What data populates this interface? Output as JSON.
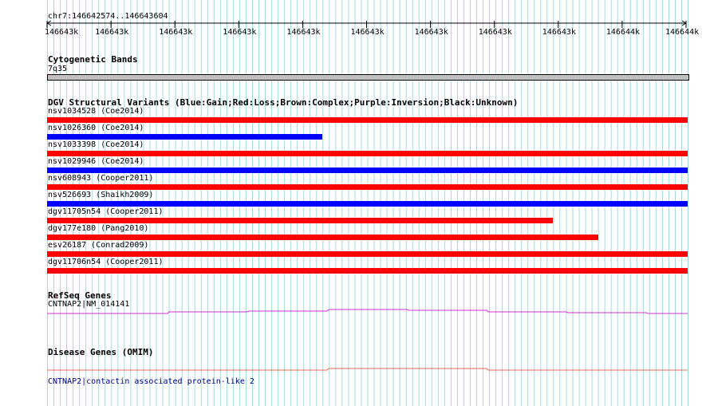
{
  "ruler": {
    "coords": "chr7:146642574..146643604",
    "tick_labels": [
      "146643k",
      "146643k",
      "146643k",
      "146643k",
      "146643k",
      "146643k",
      "146643k",
      "146643k",
      "146643k",
      "146644k",
      "146644k"
    ]
  },
  "cytoband": {
    "title": "Cytogenetic Bands",
    "band_label": "7q35",
    "band_color": "#c0c0c0"
  },
  "dgv": {
    "title": "DGV Structural Variants (Blue:Gain;Red:Loss;Brown:Complex;Purple:Inversion;Black:Unknown)",
    "variants": [
      {
        "label": "nsv1034528 (Coe2014)",
        "color": "#ff0000",
        "extent": 1.0
      },
      {
        "label": "nsv1026360 (Coe2014)",
        "color": "#0000ff",
        "extent": 0.43
      },
      {
        "label": "nsv1033398 (Coe2014)",
        "color": "#ff0000",
        "extent": 1.0
      },
      {
        "label": "nsv1029946 (Coe2014)",
        "color": "#0000ff",
        "extent": 1.0
      },
      {
        "label": "nsv608943 (Cooper2011)",
        "color": "#ff0000",
        "extent": 1.0
      },
      {
        "label": "nsv526693 (Shaikh2009)",
        "color": "#0000ff",
        "extent": 1.0
      },
      {
        "label": "dgv11705n54 (Cooper2011)",
        "color": "#ff0000",
        "extent": 0.79
      },
      {
        "label": "dgv177e180 (Pang2010)",
        "color": "#ff0000",
        "extent": 0.86
      },
      {
        "label": "esv26187 (Conrad2009)",
        "color": "#ff0000",
        "extent": 1.0
      },
      {
        "label": "dgv11706n54 (Cooper2011)",
        "color": "#ff0000",
        "extent": 1.0
      }
    ]
  },
  "refseq": {
    "title": "RefSeq Genes",
    "gene_label": "CNTNAP2|NM_014141",
    "line_color": "#cc33cc"
  },
  "omim": {
    "title": "Disease Genes (OMIM)",
    "gene_label": "CNTNAP2|contactin associated protein-like 2",
    "line_color": "#e07050"
  },
  "colors": {
    "gridline": "#a6d8e0",
    "text": "#000000",
    "link": "#000080"
  }
}
